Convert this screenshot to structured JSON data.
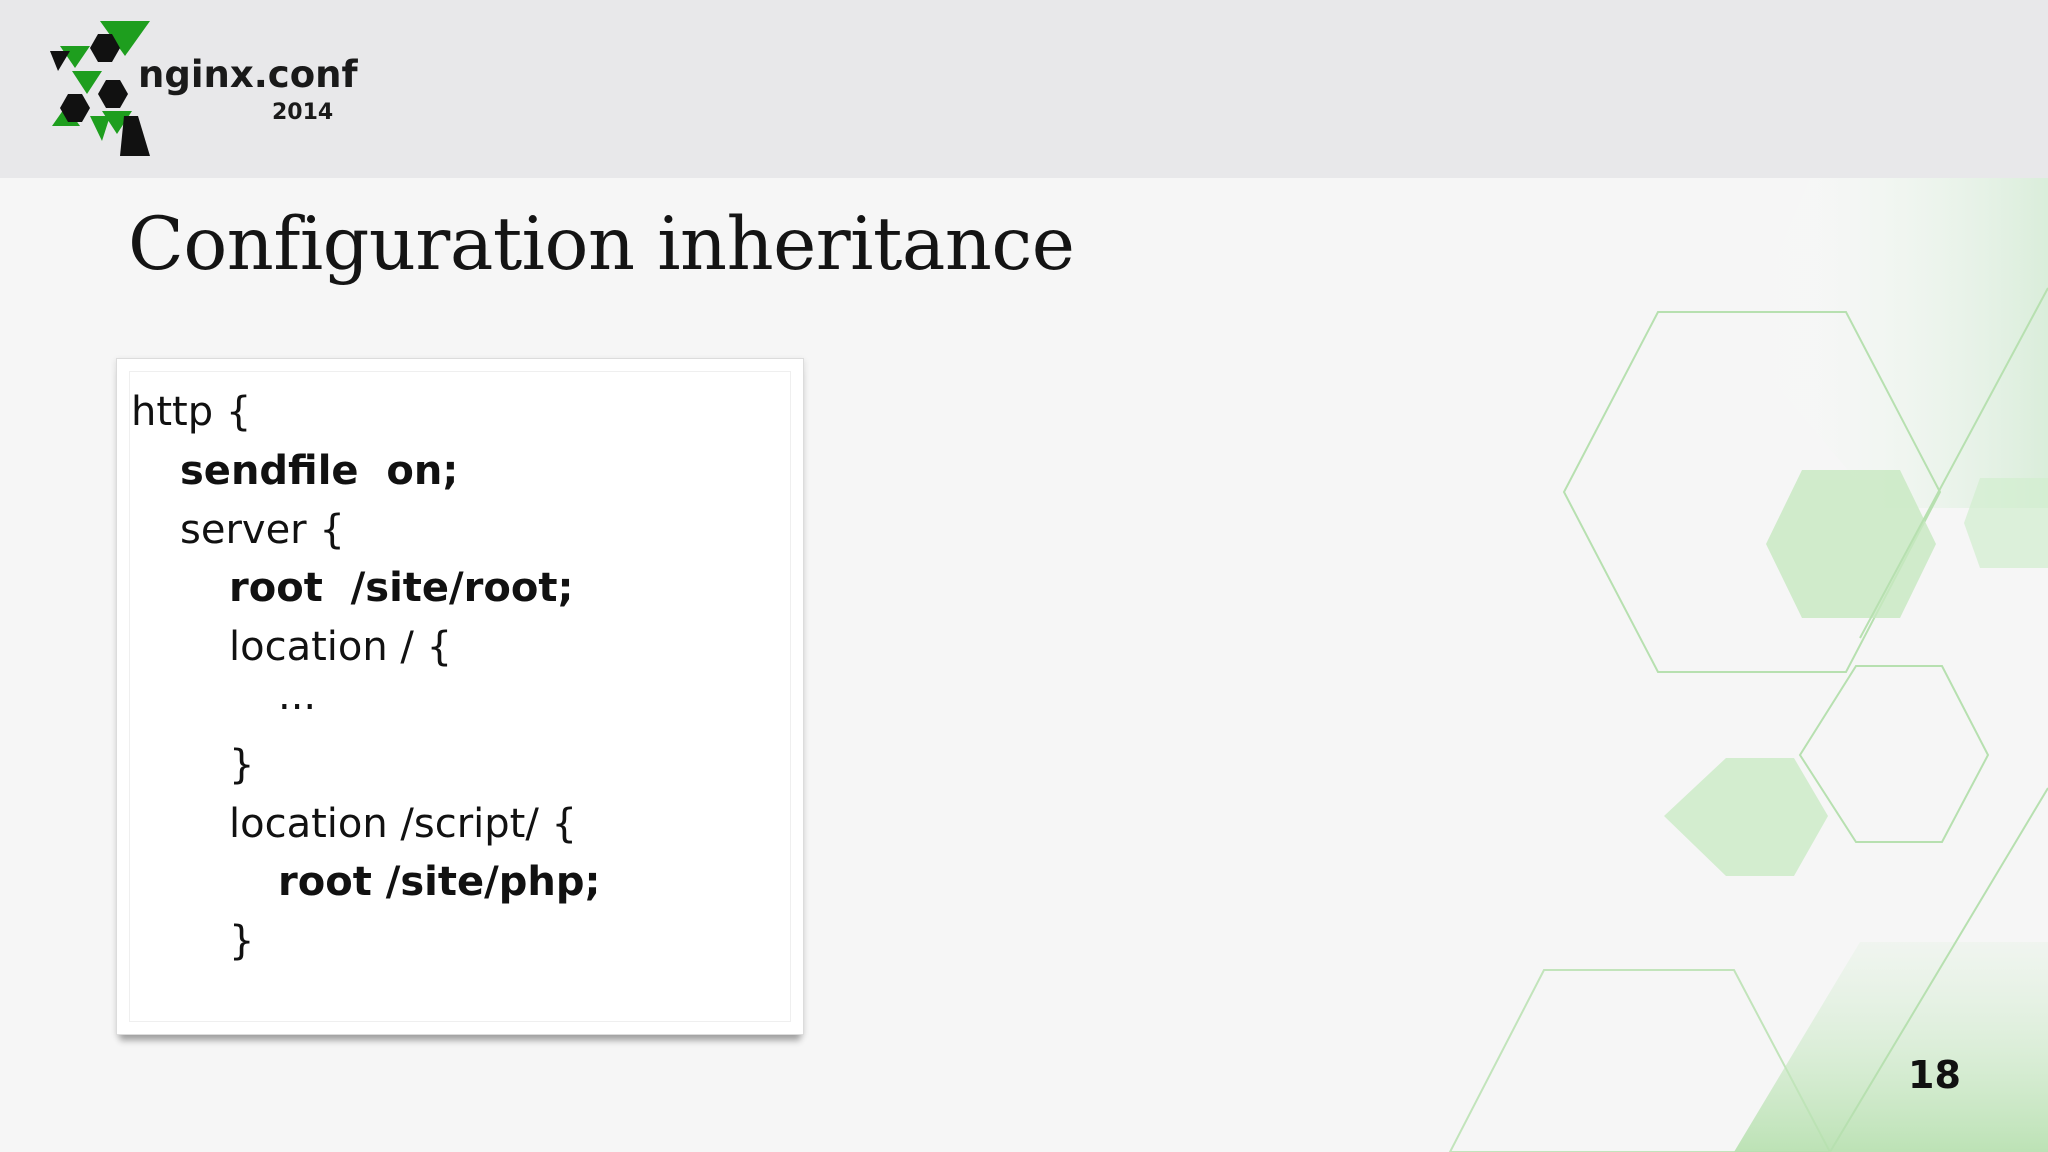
{
  "header": {
    "logo_name": "nginx.conf",
    "logo_year": "2014",
    "logo_icon": "hexagon-x-icon",
    "colors": {
      "green": "#1a9a1a",
      "dark": "#111111"
    }
  },
  "slide": {
    "title": "Configuration inheritance",
    "page_number": "18"
  },
  "code": {
    "lines": [
      "http {",
      "sendfile  on;",
      "server {",
      "root  /site/root;",
      "location / {",
      "...",
      "}",
      "location /script/ {",
      "root /site/php;",
      "}"
    ]
  },
  "decor": {
    "accent": "#b9e0b2",
    "line": "#a8dba0"
  }
}
